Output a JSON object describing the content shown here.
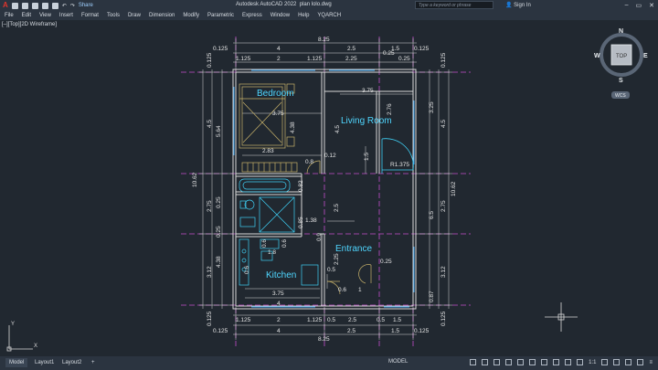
{
  "app": {
    "title": "Autodesk AutoCAD 2022",
    "filename": "plan lolo.dwg",
    "share_label": "Share",
    "search_placeholder": "Type a keyword or phrase",
    "sign_in": "Sign In"
  },
  "menu": [
    "File",
    "Edit",
    "View",
    "Insert",
    "Format",
    "Tools",
    "Draw",
    "Dimension",
    "Modify",
    "Parametric",
    "Express",
    "Window",
    "Help",
    "YQARCH"
  ],
  "viewport_label": "[–][Top][2D Wireframe]",
  "viewcube": {
    "top": "TOP",
    "n": "N",
    "s": "S",
    "e": "E",
    "w": "W",
    "wcs": "WCS"
  },
  "rooms": {
    "bedroom": "Bedroom",
    "living": "Living Room",
    "entrance": "Entrance",
    "kitchen": "Kitchen"
  },
  "dims": {
    "top_total": "8.25",
    "top_0125": "0.125",
    "top_4": "4",
    "top_25": "2.5",
    "top_15": "1.5",
    "top_0125b": "0.125",
    "t2_1125": "1.125",
    "t2_2": "2",
    "t2_1125b": "1.125",
    "t2_225": "2.25",
    "t2_025": "0.25",
    "t2_025b": "0.25",
    "bot_total": "8.25",
    "bot_0125": "0.125",
    "bot_4": "4",
    "bot_25": "2.5",
    "bot_15": "1.5",
    "bot_0125b": "0.125",
    "b2_1125": "1.125",
    "b2_2": "2",
    "b2_1125b": "1.125",
    "b2_05": "0.5",
    "b2_25": "2.5",
    "b2_05b": "0.5",
    "b2_15": "1.5",
    "left_1062": "10.62",
    "left_45": "4.5",
    "left_564": "5.64",
    "left_275": "2.75",
    "left_438": "4.38",
    "left_312": "3.12",
    "left_0125": "0.125",
    "left_0125b": "0.125",
    "left_025": "0.25",
    "left_025b": "0.25",
    "right_1062": "10.62",
    "right_325": "3.25",
    "right_45": "4.5",
    "right_65": "6.5",
    "right_275": "2.75",
    "right_312": "3.12",
    "right_087": "0.87",
    "right_0125": "0.125",
    "right_0125b": "0.125",
    "in_375": "3.75",
    "in_438": "4.38",
    "in_283": "2.83",
    "in_375b": "3.75",
    "in_276": "2.76",
    "in_45": "4.5",
    "in_15": "1.5",
    "in_r": "R1.375",
    "in_08": "0.8",
    "in_012": "0.12",
    "in_082": "0.82",
    "in_25": "2.5",
    "in_138": "1.38",
    "in_085": "0.85",
    "in_09": "0.9",
    "in_06": "0.6",
    "in_06b": "0.6",
    "in_18": "1.8",
    "in_06c": "0.6",
    "in_225": "2.25",
    "in_025": "0.25",
    "in_05": "0.5",
    "in_06d": "0.6",
    "in_1": "1",
    "in_375c": "3.75",
    "in_4": "4"
  },
  "status": {
    "tabs": [
      "Model",
      "Layout1",
      "Layout2"
    ],
    "model": "MODEL",
    "scale": "1:1"
  }
}
